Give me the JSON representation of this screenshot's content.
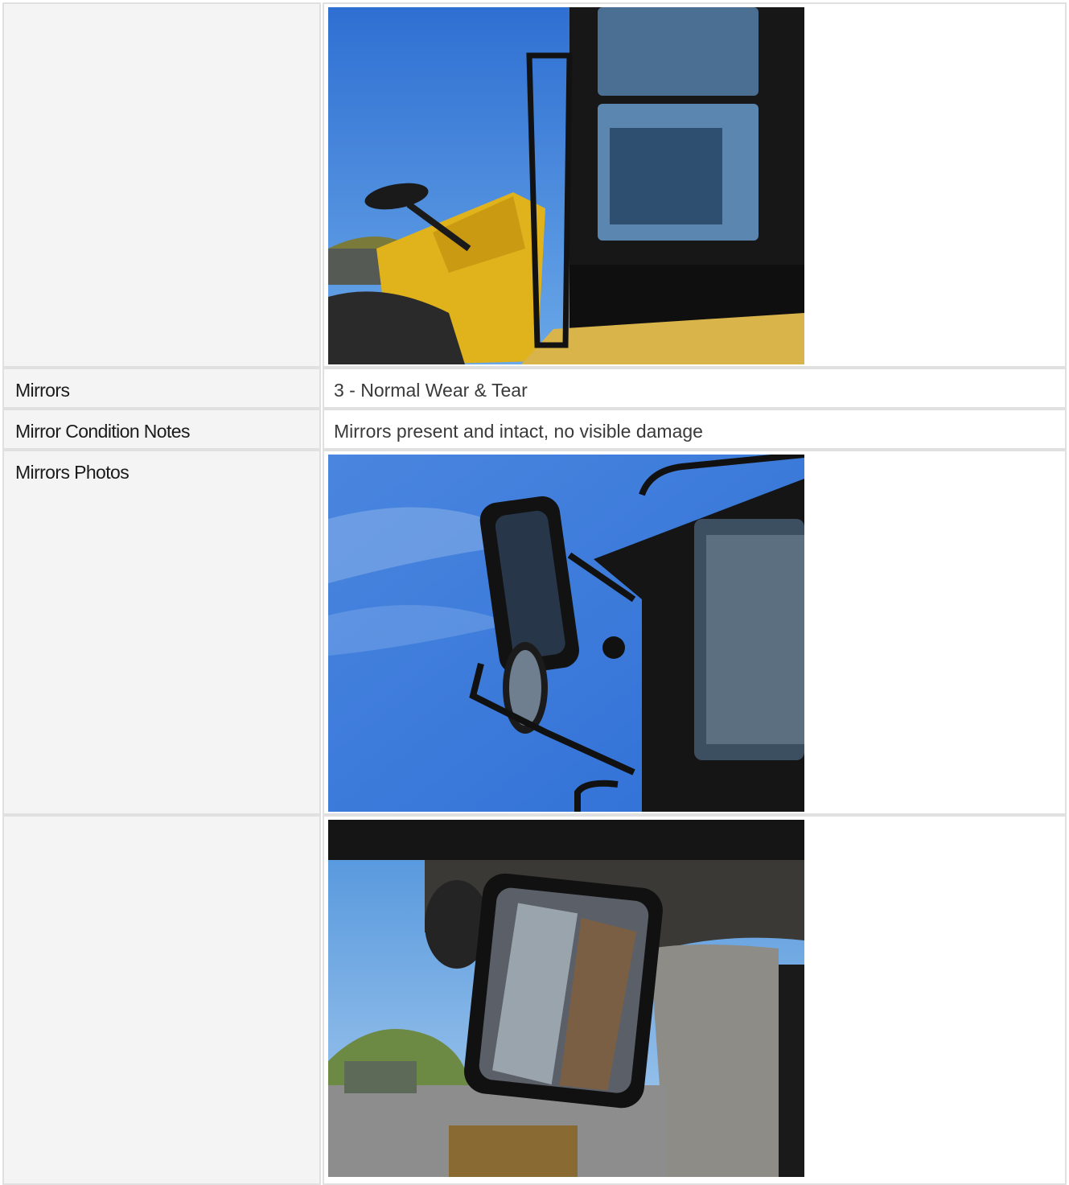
{
  "rows": [
    {
      "label": "",
      "value": ""
    },
    {
      "label": "Mirrors",
      "value": "3 - Normal Wear & Tear"
    },
    {
      "label": "Mirror Condition Notes",
      "value": "Mirrors present and intact, no visible damage"
    },
    {
      "label": "Mirrors Photos",
      "value": ""
    },
    {
      "label": "",
      "value": ""
    }
  ],
  "photos": [
    {
      "name": "loader-cab-exterior-photo",
      "colors": {
        "sky": "#3f7fd6",
        "body": "#e0b21c",
        "frame": "#141414"
      }
    },
    {
      "name": "side-mirror-photo",
      "colors": {
        "sky": "#3576db",
        "frame": "#101010"
      }
    },
    {
      "name": "interior-mirror-photo",
      "colors": {
        "ceiling": "#2e2d2b",
        "pillar": "#8b8a85",
        "sky": "#6aa9e6"
      }
    }
  ]
}
